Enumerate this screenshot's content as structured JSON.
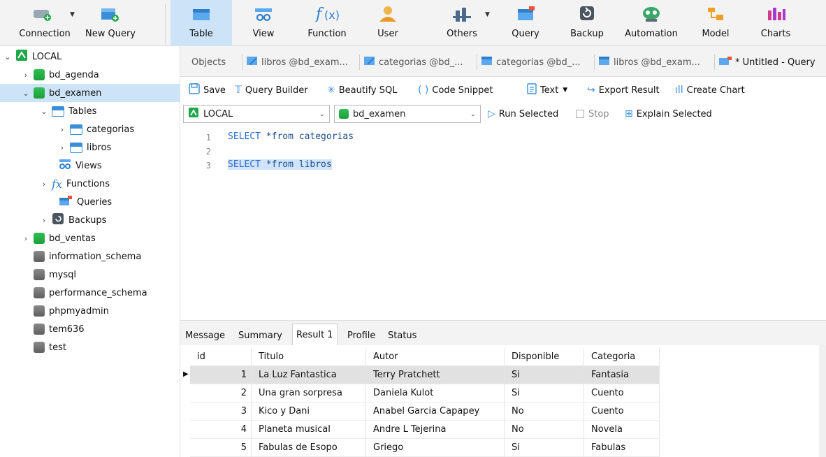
{
  "toolbar": {
    "connection": "Connection",
    "new_query": "New Query",
    "table": "Table",
    "view": "View",
    "function": "Function",
    "user": "User",
    "others": "Others",
    "query": "Query",
    "backup": "Backup",
    "automation": "Automation",
    "model": "Model",
    "charts": "Charts"
  },
  "tree": {
    "local": "LOCAL",
    "bd_agenda": "bd_agenda",
    "bd_examen": "bd_examen",
    "tables": "Tables",
    "categorias": "categorias",
    "libros": "libros",
    "views": "Views",
    "functions": "Functions",
    "queries": "Queries",
    "backups": "Backups",
    "bd_ventas": "bd_ventas",
    "information_schema": "information_schema",
    "mysql": "mysql",
    "performance_schema": "performance_schema",
    "phpmyadmin": "phpmyadmin",
    "tem636": "tem636",
    "test": "test"
  },
  "tabs": {
    "objects": "Objects",
    "t1": "libros @bd_exam...",
    "t2": "categorias @bd_...",
    "t3": "categorias @bd_...",
    "t4": "libros @bd_exam...",
    "t5": "* Untitled - Query"
  },
  "editbar": {
    "save": "Save",
    "query_builder": "Query Builder",
    "beautify": "Beautify SQL",
    "snippet": "Code Snippet",
    "text": "Text",
    "export": "Export Result",
    "create_chart": "Create Chart"
  },
  "connrow": {
    "connection": "LOCAL",
    "database": "bd_examen",
    "run_selected": "Run Selected",
    "stop": "Stop",
    "explain": "Explain Selected"
  },
  "editor": {
    "ln1": "1",
    "ln2": "2",
    "ln3": "3",
    "line1_kw": "SELECT",
    "line1_rest": " *from categorias",
    "line3_kw": "SELECT",
    "line3_rest": " *from libros"
  },
  "result_tabs": {
    "message": "Message",
    "summary": "Summary",
    "result1": "Result 1",
    "profile": "Profile",
    "status": "Status"
  },
  "grid": {
    "headers": [
      "id",
      "Titulo",
      "Autor",
      "Disponible",
      "Categoria"
    ],
    "rows": [
      [
        "1",
        "La Luz Fantastica",
        "Terry Pratchett",
        "Si",
        "Fantasia"
      ],
      [
        "2",
        "Una gran sorpresa",
        "Daniela Kulot",
        "Si",
        "Cuento"
      ],
      [
        "3",
        "Kico y Dani",
        "Anabel Garcia Capapey",
        "No",
        "Cuento"
      ],
      [
        "4",
        "Planeta musical",
        "Andre L Tejerina",
        "No",
        "Novela"
      ],
      [
        "5",
        "Fabulas de Esopo",
        "Griego",
        "Si",
        "Fabulas"
      ]
    ]
  }
}
